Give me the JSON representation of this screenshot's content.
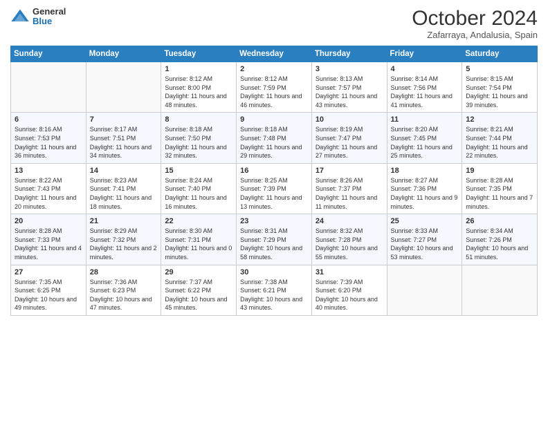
{
  "header": {
    "logo_general": "General",
    "logo_blue": "Blue",
    "month_title": "October 2024",
    "subtitle": "Zafarraya, Andalusia, Spain"
  },
  "days_of_week": [
    "Sunday",
    "Monday",
    "Tuesday",
    "Wednesday",
    "Thursday",
    "Friday",
    "Saturday"
  ],
  "weeks": [
    [
      {
        "day": "",
        "detail": ""
      },
      {
        "day": "",
        "detail": ""
      },
      {
        "day": "1",
        "detail": "Sunrise: 8:12 AM\nSunset: 8:00 PM\nDaylight: 11 hours and 48 minutes."
      },
      {
        "day": "2",
        "detail": "Sunrise: 8:12 AM\nSunset: 7:59 PM\nDaylight: 11 hours and 46 minutes."
      },
      {
        "day": "3",
        "detail": "Sunrise: 8:13 AM\nSunset: 7:57 PM\nDaylight: 11 hours and 43 minutes."
      },
      {
        "day": "4",
        "detail": "Sunrise: 8:14 AM\nSunset: 7:56 PM\nDaylight: 11 hours and 41 minutes."
      },
      {
        "day": "5",
        "detail": "Sunrise: 8:15 AM\nSunset: 7:54 PM\nDaylight: 11 hours and 39 minutes."
      }
    ],
    [
      {
        "day": "6",
        "detail": "Sunrise: 8:16 AM\nSunset: 7:53 PM\nDaylight: 11 hours and 36 minutes."
      },
      {
        "day": "7",
        "detail": "Sunrise: 8:17 AM\nSunset: 7:51 PM\nDaylight: 11 hours and 34 minutes."
      },
      {
        "day": "8",
        "detail": "Sunrise: 8:18 AM\nSunset: 7:50 PM\nDaylight: 11 hours and 32 minutes."
      },
      {
        "day": "9",
        "detail": "Sunrise: 8:18 AM\nSunset: 7:48 PM\nDaylight: 11 hours and 29 minutes."
      },
      {
        "day": "10",
        "detail": "Sunrise: 8:19 AM\nSunset: 7:47 PM\nDaylight: 11 hours and 27 minutes."
      },
      {
        "day": "11",
        "detail": "Sunrise: 8:20 AM\nSunset: 7:45 PM\nDaylight: 11 hours and 25 minutes."
      },
      {
        "day": "12",
        "detail": "Sunrise: 8:21 AM\nSunset: 7:44 PM\nDaylight: 11 hours and 22 minutes."
      }
    ],
    [
      {
        "day": "13",
        "detail": "Sunrise: 8:22 AM\nSunset: 7:43 PM\nDaylight: 11 hours and 20 minutes."
      },
      {
        "day": "14",
        "detail": "Sunrise: 8:23 AM\nSunset: 7:41 PM\nDaylight: 11 hours and 18 minutes."
      },
      {
        "day": "15",
        "detail": "Sunrise: 8:24 AM\nSunset: 7:40 PM\nDaylight: 11 hours and 16 minutes."
      },
      {
        "day": "16",
        "detail": "Sunrise: 8:25 AM\nSunset: 7:39 PM\nDaylight: 11 hours and 13 minutes."
      },
      {
        "day": "17",
        "detail": "Sunrise: 8:26 AM\nSunset: 7:37 PM\nDaylight: 11 hours and 11 minutes."
      },
      {
        "day": "18",
        "detail": "Sunrise: 8:27 AM\nSunset: 7:36 PM\nDaylight: 11 hours and 9 minutes."
      },
      {
        "day": "19",
        "detail": "Sunrise: 8:28 AM\nSunset: 7:35 PM\nDaylight: 11 hours and 7 minutes."
      }
    ],
    [
      {
        "day": "20",
        "detail": "Sunrise: 8:28 AM\nSunset: 7:33 PM\nDaylight: 11 hours and 4 minutes."
      },
      {
        "day": "21",
        "detail": "Sunrise: 8:29 AM\nSunset: 7:32 PM\nDaylight: 11 hours and 2 minutes."
      },
      {
        "day": "22",
        "detail": "Sunrise: 8:30 AM\nSunset: 7:31 PM\nDaylight: 11 hours and 0 minutes."
      },
      {
        "day": "23",
        "detail": "Sunrise: 8:31 AM\nSunset: 7:29 PM\nDaylight: 10 hours and 58 minutes."
      },
      {
        "day": "24",
        "detail": "Sunrise: 8:32 AM\nSunset: 7:28 PM\nDaylight: 10 hours and 55 minutes."
      },
      {
        "day": "25",
        "detail": "Sunrise: 8:33 AM\nSunset: 7:27 PM\nDaylight: 10 hours and 53 minutes."
      },
      {
        "day": "26",
        "detail": "Sunrise: 8:34 AM\nSunset: 7:26 PM\nDaylight: 10 hours and 51 minutes."
      }
    ],
    [
      {
        "day": "27",
        "detail": "Sunrise: 7:35 AM\nSunset: 6:25 PM\nDaylight: 10 hours and 49 minutes."
      },
      {
        "day": "28",
        "detail": "Sunrise: 7:36 AM\nSunset: 6:23 PM\nDaylight: 10 hours and 47 minutes."
      },
      {
        "day": "29",
        "detail": "Sunrise: 7:37 AM\nSunset: 6:22 PM\nDaylight: 10 hours and 45 minutes."
      },
      {
        "day": "30",
        "detail": "Sunrise: 7:38 AM\nSunset: 6:21 PM\nDaylight: 10 hours and 43 minutes."
      },
      {
        "day": "31",
        "detail": "Sunrise: 7:39 AM\nSunset: 6:20 PM\nDaylight: 10 hours and 40 minutes."
      },
      {
        "day": "",
        "detail": ""
      },
      {
        "day": "",
        "detail": ""
      }
    ]
  ]
}
